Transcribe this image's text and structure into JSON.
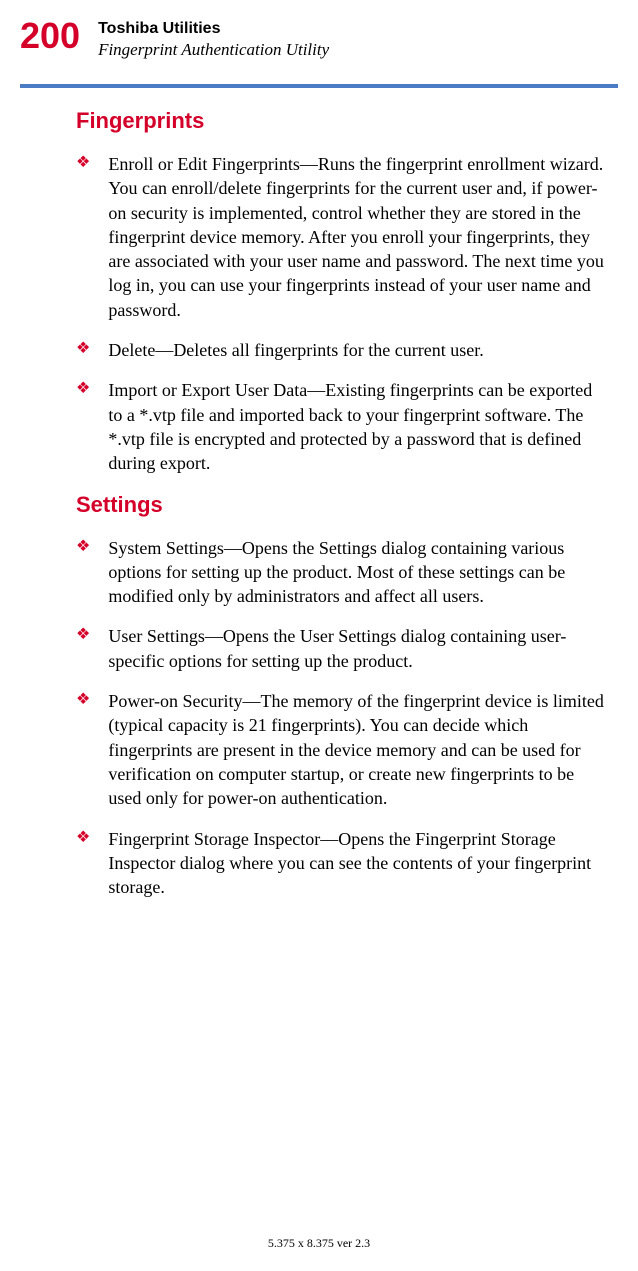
{
  "header": {
    "page_number": "200",
    "title": "Toshiba Utilities",
    "subtitle": "Fingerprint Authentication Utility"
  },
  "sections": [
    {
      "heading": "Fingerprints",
      "items": [
        "Enroll or Edit Fingerprints—Runs the fingerprint enrollment wizard. You can enroll/delete fingerprints for the current user and, if power-on security is implemented, control whether they are stored in the fingerprint device memory. After you enroll your fingerprints, they are associated with your user name and password. The next time you log in, you can use your fingerprints instead of your user name and password.",
        "Delete—Deletes all fingerprints for the current user.",
        "Import or Export User Data—Existing fingerprints can be exported to a *.vtp file and imported back to your fingerprint software. The *.vtp file is encrypted and protected by a password that is defined during export."
      ]
    },
    {
      "heading": "Settings",
      "items": [
        "System Settings—Opens the Settings dialog containing various options for setting up the product. Most of these settings can be modified only by administrators and affect all users.",
        "User Settings—Opens the User Settings dialog containing user-specific options for setting up the product.",
        "Power-on Security—The memory of the fingerprint device is limited (typical capacity is 21 fingerprints). You can decide which fingerprints are present in the device memory and can be used for verification on computer startup, or create new fingerprints to be used only for power-on authentication.",
        "Fingerprint Storage Inspector—Opens the Fingerprint Storage Inspector dialog where you can see the contents of your fingerprint storage."
      ]
    }
  ],
  "footer": "5.375 x 8.375 ver 2.3"
}
